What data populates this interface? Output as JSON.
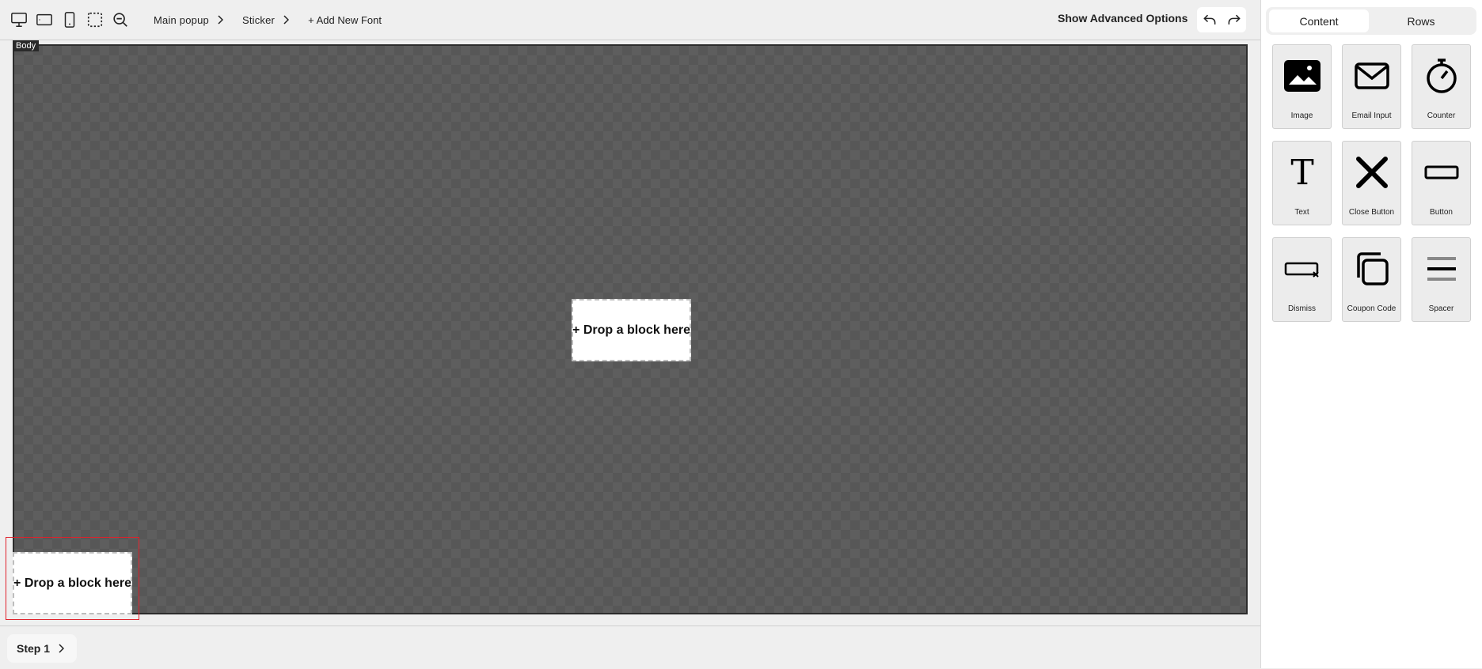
{
  "toolbar": {
    "device_icons": [
      "desktop-icon",
      "tablet-landscape-icon",
      "mobile-icon",
      "select-area-icon",
      "zoom-out-icon"
    ],
    "breadcrumbs": [
      {
        "label": "Main popup"
      },
      {
        "label": "Sticker"
      }
    ],
    "add_font": "+ Add New Font",
    "advanced_options": "Show Advanced Options",
    "undo_icon": "undo-icon",
    "redo_icon": "redo-icon"
  },
  "canvas": {
    "body_tag": "Body",
    "drop_center": "+ Drop a block here",
    "drop_corner": "+ Drop a block here"
  },
  "bottom": {
    "step_label": "Step 1"
  },
  "panel": {
    "tabs": [
      {
        "label": "Content",
        "active": true
      },
      {
        "label": "Rows",
        "active": false
      }
    ],
    "blocks": [
      {
        "label": "Image",
        "icon": "image-icon"
      },
      {
        "label": "Email Input",
        "icon": "envelope-icon"
      },
      {
        "label": "Counter",
        "icon": "stopwatch-icon"
      },
      {
        "label": "Text",
        "icon": "text-t-icon"
      },
      {
        "label": "Close Button",
        "icon": "close-x-icon"
      },
      {
        "label": "Button",
        "icon": "button-rect-icon"
      },
      {
        "label": "Dismiss",
        "icon": "dismiss-icon"
      },
      {
        "label": "Coupon Code",
        "icon": "copy-icon"
      },
      {
        "label": "Spacer",
        "icon": "spacer-lines-icon"
      }
    ]
  },
  "colors": {
    "selection_outline": "#e0202a",
    "canvas_bg": "#575757"
  }
}
